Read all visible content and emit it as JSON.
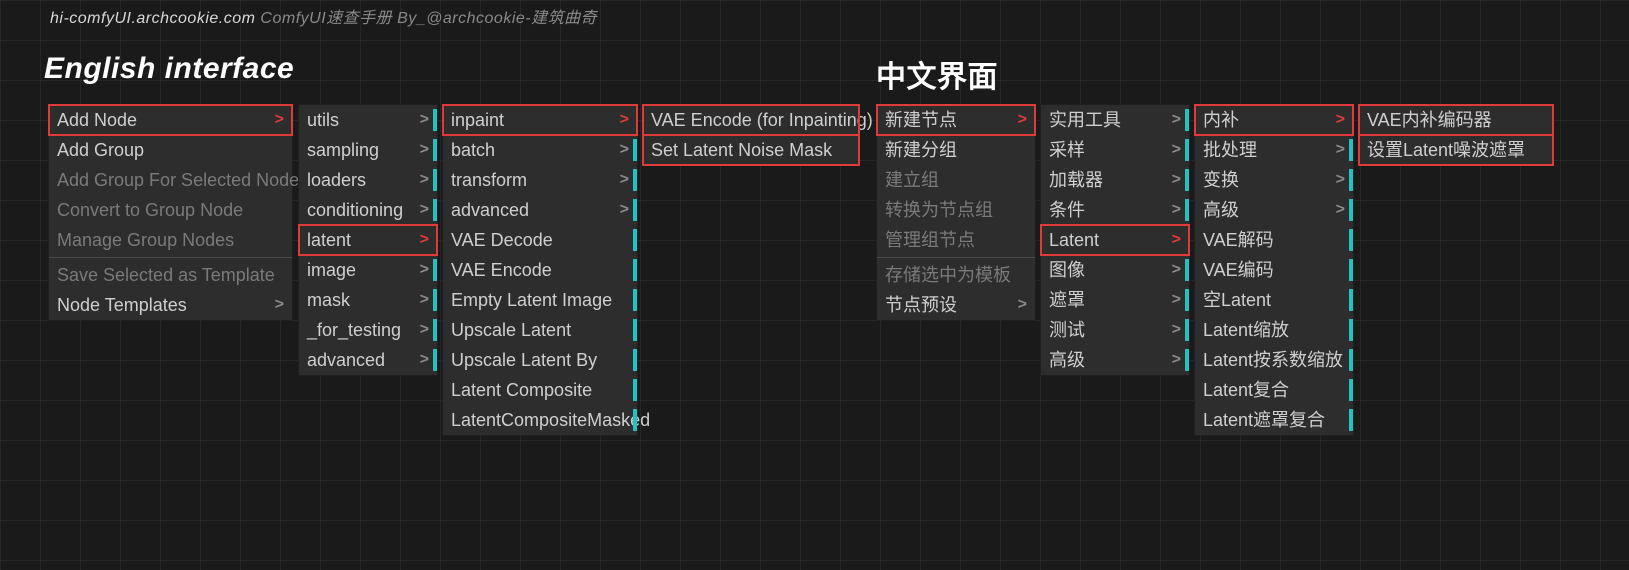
{
  "topbar": {
    "url": "hi-comfyUI.archcookie.com",
    "rest": "ComfyUI速查手册 By_@archcookie-建筑曲奇"
  },
  "headings": {
    "en": "English interface",
    "cn": "中文界面"
  },
  "en1": [
    {
      "label": "Add Node",
      "arr": true,
      "hl": true
    },
    {
      "label": "Add Group"
    },
    {
      "label": "Add Group For Selected Nodes",
      "dim": true
    },
    {
      "label": "Convert to Group Node",
      "dim": true
    },
    {
      "label": "Manage Group Nodes",
      "dim": true
    },
    {
      "sep": true
    },
    {
      "label": "Save Selected as Template",
      "dim": true
    },
    {
      "label": "Node Templates",
      "arr": true
    }
  ],
  "en2": [
    {
      "label": "utils",
      "arr": true,
      "teal": true
    },
    {
      "label": "sampling",
      "arr": true,
      "teal": true
    },
    {
      "label": "loaders",
      "arr": true,
      "teal": true
    },
    {
      "label": "conditioning",
      "arr": true,
      "teal": true
    },
    {
      "label": "latent",
      "arr": true,
      "hl": true
    },
    {
      "label": "image",
      "arr": true,
      "teal": true
    },
    {
      "label": "mask",
      "arr": true,
      "teal": true
    },
    {
      "label": "_for_testing",
      "arr": true,
      "teal": true
    },
    {
      "label": "advanced",
      "arr": true,
      "teal": true
    }
  ],
  "en3": [
    {
      "label": "inpaint",
      "arr": true,
      "hl": true
    },
    {
      "label": "batch",
      "arr": true,
      "teal": true
    },
    {
      "label": "transform",
      "arr": true,
      "teal": true
    },
    {
      "label": "advanced",
      "arr": true,
      "teal": true
    },
    {
      "label": "VAE Decode",
      "teal": true
    },
    {
      "label": "VAE Encode",
      "teal": true
    },
    {
      "label": "Empty Latent Image",
      "teal": true
    },
    {
      "label": "Upscale Latent",
      "teal": true
    },
    {
      "label": "Upscale Latent By",
      "teal": true
    },
    {
      "label": "Latent Composite",
      "teal": true
    },
    {
      "label": "LatentCompositeMasked",
      "teal": true
    }
  ],
  "en4": [
    {
      "label": "VAE Encode (for Inpainting)",
      "hl": true
    },
    {
      "label": "Set Latent Noise Mask",
      "hl": true
    }
  ],
  "cn1": [
    {
      "label": "新建节点",
      "arr": true,
      "hl": true
    },
    {
      "label": "新建分组"
    },
    {
      "label": "建立组",
      "dim": true
    },
    {
      "label": "转换为节点组",
      "dim": true
    },
    {
      "label": "管理组节点",
      "dim": true
    },
    {
      "sep": true
    },
    {
      "label": "存储选中为模板",
      "dim": true
    },
    {
      "label": "节点预设",
      "arr": true
    }
  ],
  "cn2": [
    {
      "label": "实用工具",
      "arr": true,
      "teal": true
    },
    {
      "label": "采样",
      "arr": true,
      "teal": true
    },
    {
      "label": "加载器",
      "arr": true,
      "teal": true
    },
    {
      "label": "条件",
      "arr": true,
      "teal": true
    },
    {
      "label": "Latent",
      "arr": true,
      "hl": true
    },
    {
      "label": "图像",
      "arr": true,
      "teal": true
    },
    {
      "label": "遮罩",
      "arr": true,
      "teal": true
    },
    {
      "label": "测试",
      "arr": true,
      "teal": true
    },
    {
      "label": "高级",
      "arr": true,
      "teal": true
    }
  ],
  "cn3": [
    {
      "label": "内补",
      "arr": true,
      "hl": true
    },
    {
      "label": "批处理",
      "arr": true,
      "teal": true
    },
    {
      "label": "变换",
      "arr": true,
      "teal": true
    },
    {
      "label": "高级",
      "arr": true,
      "teal": true
    },
    {
      "label": "VAE解码",
      "teal": true
    },
    {
      "label": "VAE编码",
      "teal": true
    },
    {
      "label": "空Latent",
      "teal": true
    },
    {
      "label": "Latent缩放",
      "teal": true
    },
    {
      "label": "Latent按系数缩放",
      "teal": true
    },
    {
      "label": "Latent复合",
      "teal": true
    },
    {
      "label": "Latent遮罩复合",
      "teal": true
    }
  ],
  "cn4": [
    {
      "label": "VAE内补编码器",
      "hl": true
    },
    {
      "label": "设置Latent噪波遮罩",
      "hl": true
    }
  ]
}
